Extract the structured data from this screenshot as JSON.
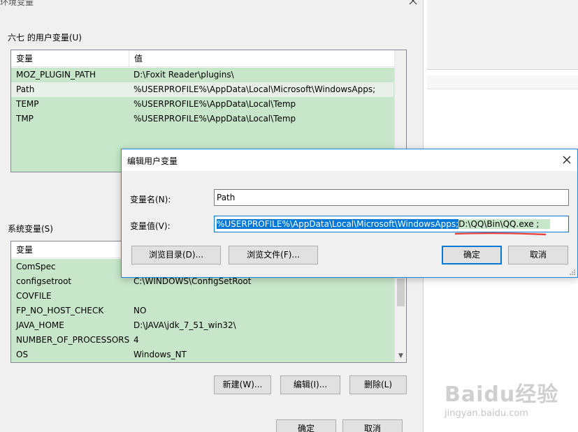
{
  "window": {
    "title": "环境变量",
    "user_group_label": "六七 的用户变量(U)",
    "system_group_label": "系统变量(S)",
    "columns": {
      "name": "变量",
      "value": "值"
    },
    "user_vars": [
      {
        "name": "MOZ_PLUGIN_PATH",
        "value": "D:\\Foxit Reader\\plugins\\"
      },
      {
        "name": "Path",
        "value": "%USERPROFILE%\\AppData\\Local\\Microsoft\\WindowsApps;"
      },
      {
        "name": "TEMP",
        "value": "%USERPROFILE%\\AppData\\Local\\Temp"
      },
      {
        "name": "TMP",
        "value": "%USERPROFILE%\\AppData\\Local\\Temp"
      }
    ],
    "system_vars": [
      {
        "name": "ComSpec",
        "value": ""
      },
      {
        "name": "configsetroot",
        "value": "C:\\WINDOWS\\ConfigSetRoot"
      },
      {
        "name": "COVFILE",
        "value": ""
      },
      {
        "name": "FP_NO_HOST_CHECK",
        "value": "NO"
      },
      {
        "name": "JAVA_HOME",
        "value": "D:\\JAVA\\jdk_7_51_win32\\"
      },
      {
        "name": "NUMBER_OF_PROCESSORS",
        "value": "4"
      },
      {
        "name": "OS",
        "value": "Windows_NT"
      }
    ],
    "buttons": {
      "new": "新建(W)...",
      "edit": "编辑(I)...",
      "delete": "删除(L)",
      "ok": "确定",
      "cancel": "取消"
    }
  },
  "dialog": {
    "title": "编辑用户变量",
    "name_label": "变量名(N):",
    "name_value": "Path",
    "value_label": "变量值(V):",
    "value_selected": "%USERPROFILE%\\AppData\\Local\\Microsoft\\WindowsApps;",
    "value_appended": "D:\\QQ\\Bin\\QQ.exe ;",
    "buttons": {
      "browse_dir": "浏览目录(D)...",
      "browse_file": "浏览文件(F)...",
      "ok": "确定",
      "cancel": "取消"
    }
  },
  "watermark": {
    "main": "Baidu经验",
    "sub": "jingyan.baidu.com"
  },
  "colors": {
    "selection": "#0078d7",
    "list_bg": "#c8e6c9",
    "underline": "#e53935"
  }
}
